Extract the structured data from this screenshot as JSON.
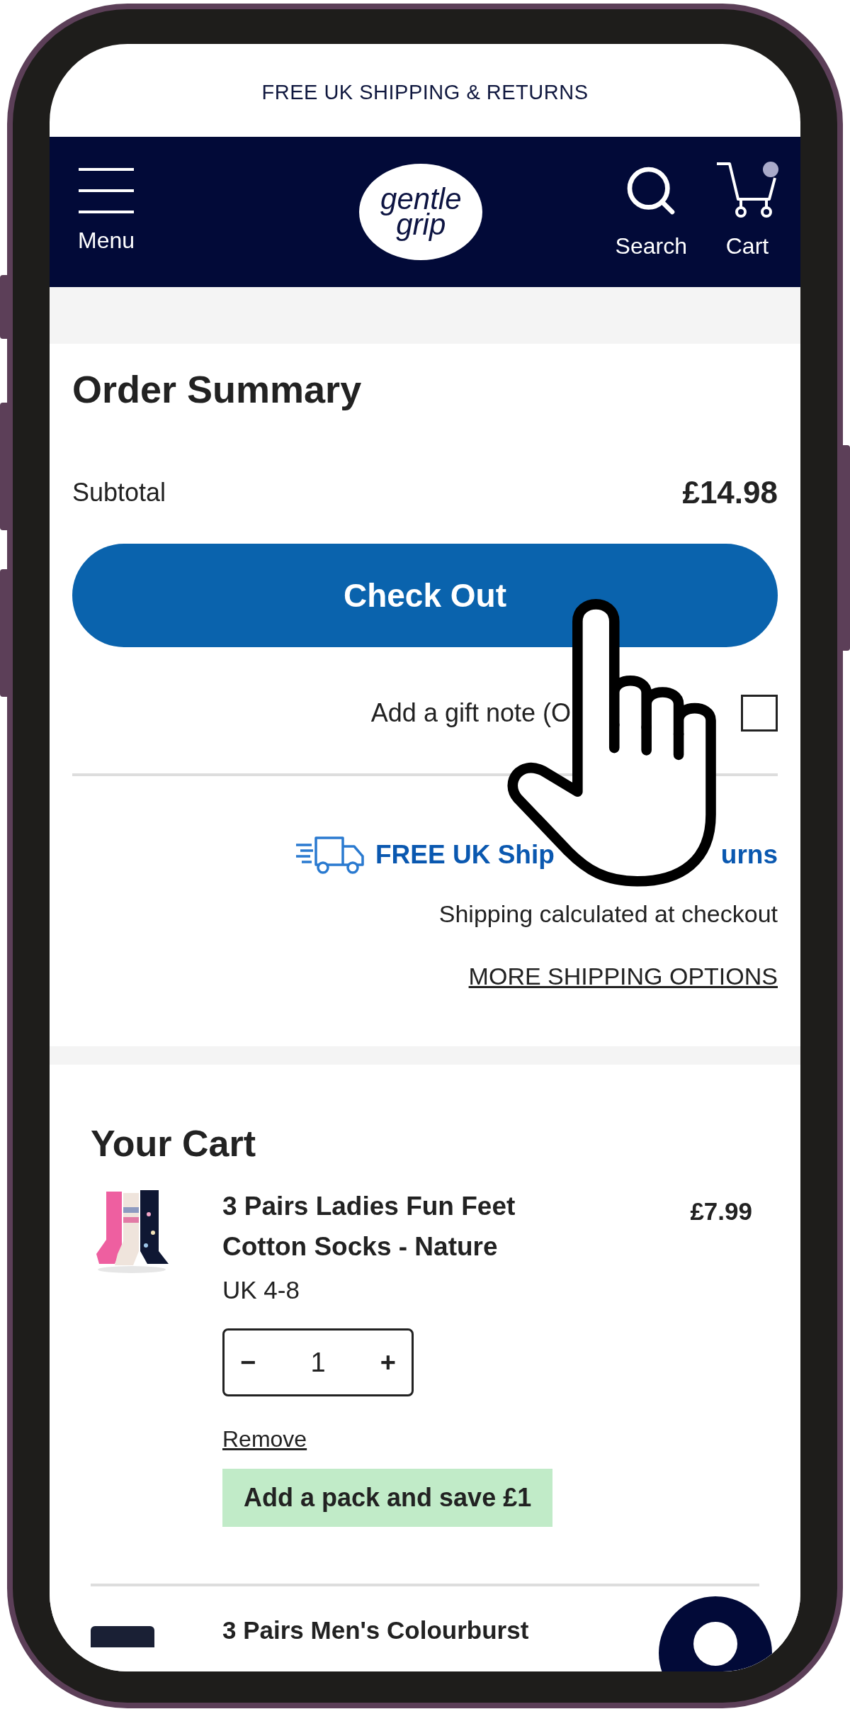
{
  "banner": {
    "text": "FREE UK SHIPPING & RETURNS"
  },
  "header": {
    "menu_label": "Menu",
    "logo_line1": "gentle",
    "logo_line2": "grip",
    "search_label": "Search",
    "cart_label": "Cart",
    "cart_has_items": true
  },
  "order_summary": {
    "title": "Order Summary",
    "subtotal_label": "Subtotal",
    "subtotal_value": "£14.98",
    "checkout_button": "Check Out",
    "gift_note_label": "Add a gift note (O",
    "gift_note_checked": false,
    "shipping_banner_start": "FREE UK Ship",
    "shipping_banner_end": "urns",
    "shipping_note": "Shipping calculated at checkout",
    "more_shipping_link": "MORE SHIPPING OPTIONS"
  },
  "cart": {
    "title": "Your Cart",
    "items": [
      {
        "name": "3 Pairs Ladies Fun Feet Cotton Socks - Nature",
        "price": "£7.99",
        "size": "UK 4-8",
        "qty_minus": "−",
        "quantity": "1",
        "qty_plus": "+",
        "remove": "Remove",
        "promo": "Add a pack and save £1"
      },
      {
        "name": "3 Pairs Men's Colourburst"
      }
    ]
  }
}
